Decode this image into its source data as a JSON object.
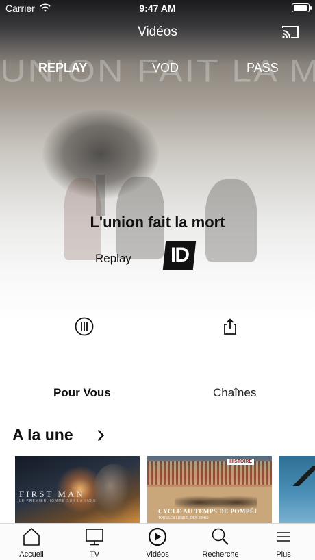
{
  "status_bar": {
    "carrier": "Carrier",
    "time": "9:47 AM",
    "icons": [
      "wifi-icon",
      "battery-icon"
    ]
  },
  "nav": {
    "title": "Vidéos",
    "cast_icon": "cast-icon"
  },
  "hero": {
    "background_text": "UNION FAIT LA MORT",
    "tabs": [
      {
        "label": "REPLAY",
        "active": true
      },
      {
        "label": "VOD",
        "active": false
      },
      {
        "label": "PASS",
        "active": false
      }
    ],
    "show_title": "L'union fait la mort",
    "category": "Replay",
    "channel_logo_text": "ID",
    "actions": {
      "library_icon": "library-icon",
      "share_icon": "share-icon"
    }
  },
  "sections": {
    "tabs": [
      {
        "label": "Pour Vous",
        "active": true
      },
      {
        "label": "Chaînes",
        "active": false
      }
    ],
    "header": "A la une",
    "header_icon": "chevron-right-icon"
  },
  "carousel": {
    "cards": [
      {
        "title": "FIRST MAN",
        "subtitle": "LE PREMIER HOMME SUR LA LUNE"
      },
      {
        "badge": "HISTOIRE",
        "title": "CYCLE AU TEMPS DE POMPÉI",
        "subtitle": "TOUS LES LUNDIS, DÈS 20H50"
      },
      {
        "title": ""
      }
    ]
  },
  "tab_bar": {
    "items": [
      {
        "label": "Accueil",
        "icon": "home-icon"
      },
      {
        "label": "TV",
        "icon": "tv-icon"
      },
      {
        "label": "Vidéos",
        "icon": "play-circle-icon",
        "active": true
      },
      {
        "label": "Recherche",
        "icon": "search-icon"
      },
      {
        "label": "Plus",
        "icon": "menu-icon"
      }
    ]
  },
  "colors": {
    "accent": "#111111",
    "tab_bar_bg": "#fbfbfb"
  }
}
